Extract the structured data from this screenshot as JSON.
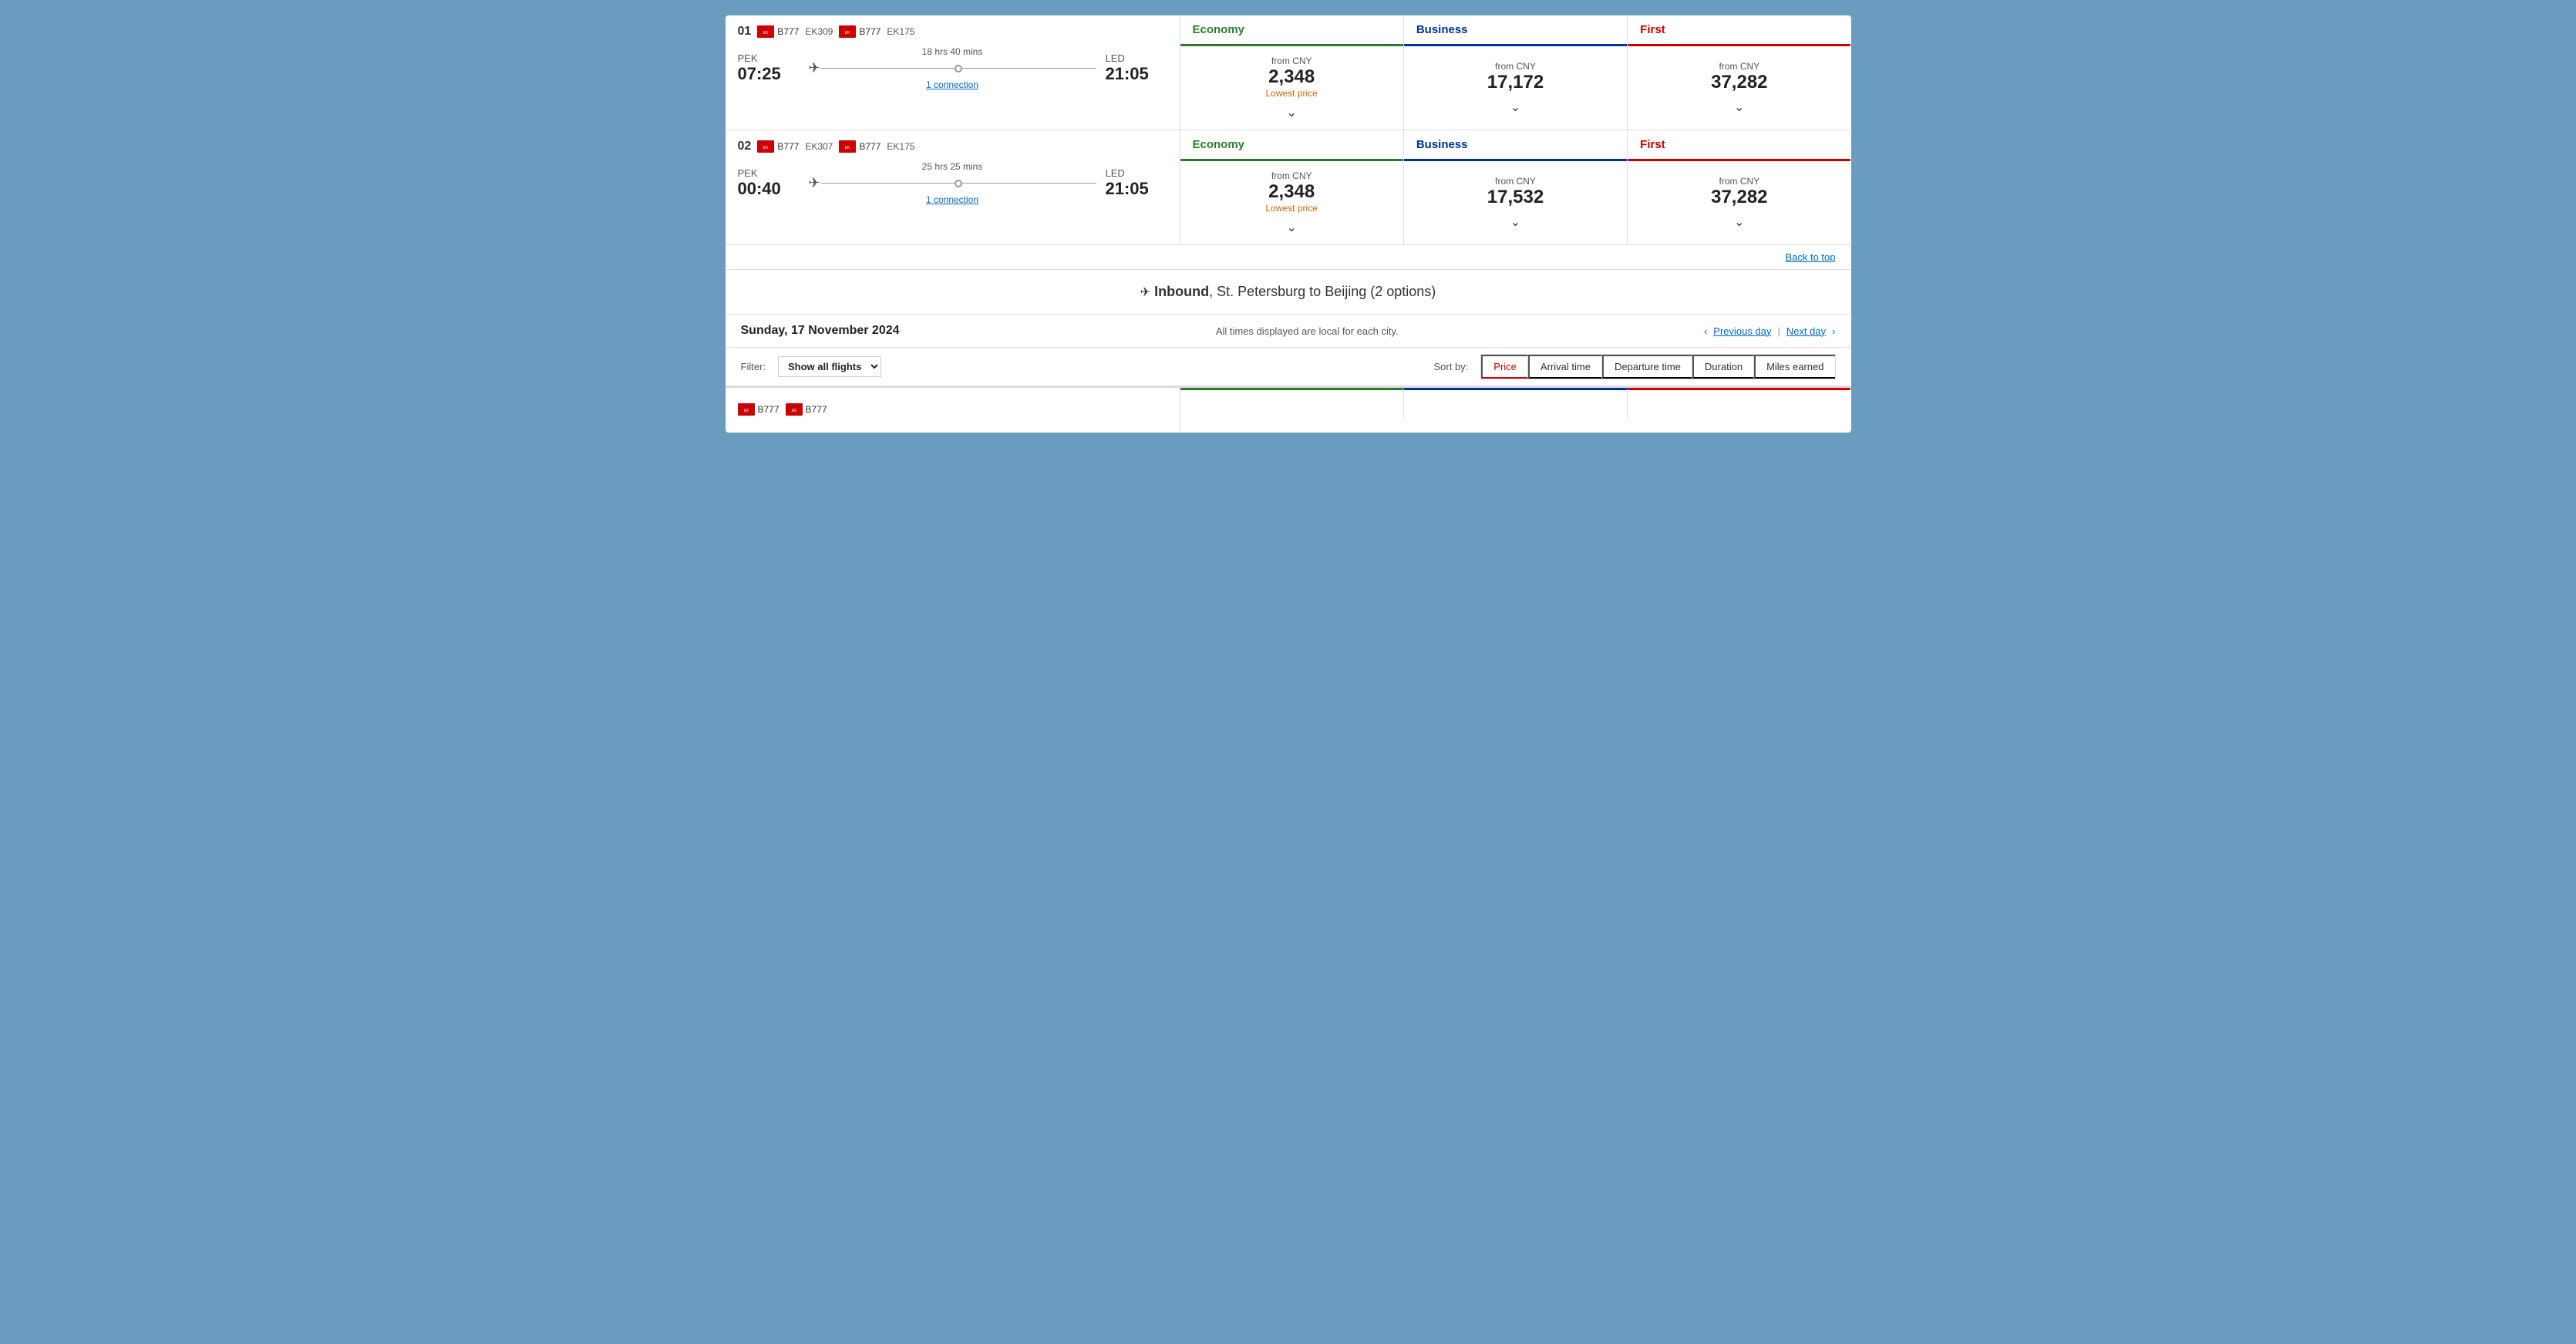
{
  "flights": [
    {
      "index": "01",
      "airlines": [
        {
          "code": "B777",
          "flight": "EK309"
        },
        {
          "code": "B777",
          "flight": "EK175"
        }
      ],
      "origin": {
        "code": "PEK",
        "time": "07:25"
      },
      "destination": {
        "code": "LED",
        "time": "21:05"
      },
      "duration": "18 hrs 40 mins",
      "connection": "1 connection",
      "economy": {
        "currency": "from CNY",
        "price": "2,348",
        "lowest": "Lowest price"
      },
      "business": {
        "currency": "from CNY",
        "price": "17,172"
      },
      "first": {
        "currency": "from CNY",
        "price": "37,282"
      }
    },
    {
      "index": "02",
      "airlines": [
        {
          "code": "B777",
          "flight": "EK307"
        },
        {
          "code": "B777",
          "flight": "EK175"
        }
      ],
      "origin": {
        "code": "PEK",
        "time": "00:40"
      },
      "destination": {
        "code": "LED",
        "time": "21:05"
      },
      "duration": "25 hrs 25 mins",
      "connection": "1 connection",
      "economy": {
        "currency": "from CNY",
        "price": "2,348",
        "lowest": "Lowest price"
      },
      "business": {
        "currency": "from CNY",
        "price": "17,532"
      },
      "first": {
        "currency": "from CNY",
        "price": "37,282"
      }
    }
  ],
  "back_to_top": "Back to top",
  "inbound": {
    "label": "Inbound",
    "route": ", St. Petersburg to Beijing (2 options)"
  },
  "date_section": {
    "date": "Sunday, 17 November 2024",
    "times_note": "All times displayed are local for each city.",
    "previous_day": "Previous day",
    "next_day": "Next day"
  },
  "filter": {
    "label": "Filter:",
    "value": "Show all flights",
    "chevron": "▾"
  },
  "sort": {
    "label": "Sort by:",
    "buttons": [
      {
        "id": "price",
        "label": "Price",
        "active": true
      },
      {
        "id": "arrival",
        "label": "Arrival time",
        "active": false
      },
      {
        "id": "departure",
        "label": "Departure time",
        "active": false
      },
      {
        "id": "duration",
        "label": "Duration",
        "active": false
      },
      {
        "id": "miles",
        "label": "Miles earned",
        "active": false
      }
    ]
  },
  "bottom_preview": {
    "airline1": "B777",
    "airline2": "B777"
  },
  "fare_headers": {
    "economy": "Economy",
    "business": "Business",
    "first": "First"
  }
}
